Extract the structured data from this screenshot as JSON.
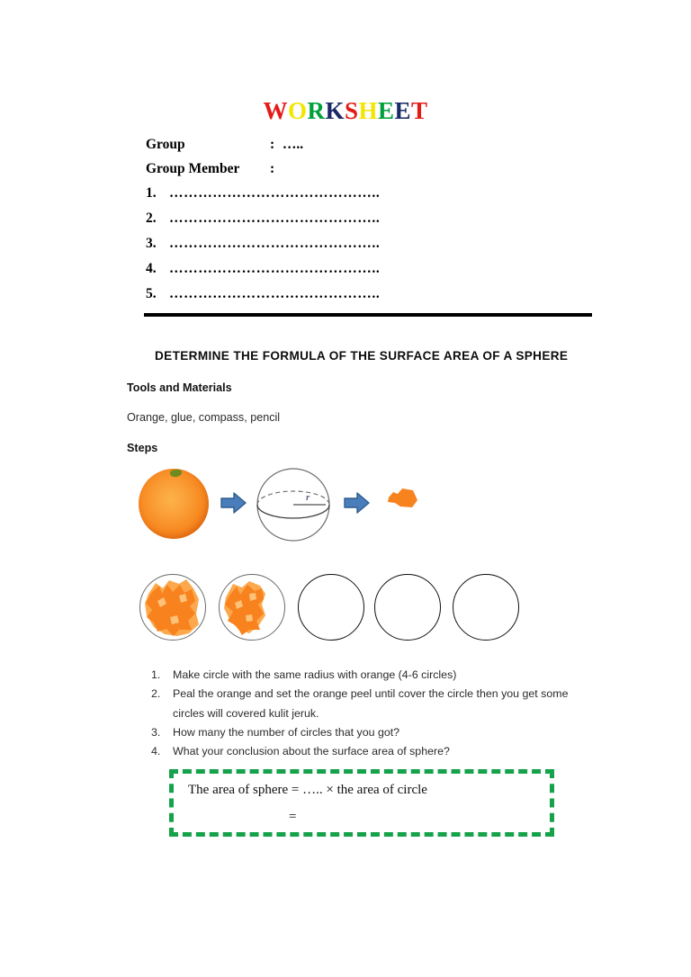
{
  "document": {
    "title_letters": [
      {
        "char": "W",
        "color": "#E31B17"
      },
      {
        "char": "O",
        "color": "#F2E500"
      },
      {
        "char": "R",
        "color": "#00A03C"
      },
      {
        "char": "K",
        "color": "#1B2A66"
      },
      {
        "char": "S",
        "color": "#E31B17"
      },
      {
        "char": "H",
        "color": "#F2E500"
      },
      {
        "char": "E",
        "color": "#00A03C"
      },
      {
        "char": "E",
        "color": "#1B2A66"
      },
      {
        "char": "T",
        "color": "#E31B17"
      }
    ],
    "title_text": "WORKSHEET"
  },
  "form": {
    "group_label": "Group",
    "group_colon": ":",
    "group_value": " …..",
    "member_label": "Group Member",
    "member_colon": ":",
    "members": [
      {
        "num": "1.",
        "dots": "…………………………………….."
      },
      {
        "num": "2.",
        "dots": "…………………………………….."
      },
      {
        "num": "3.",
        "dots": "…………………………………….."
      },
      {
        "num": "4.",
        "dots": "…………………………………….."
      },
      {
        "num": "5.",
        "dots": "…………………………………….."
      }
    ]
  },
  "activity": {
    "heading": "DETERMINE THE FORMULA OF THE SURFACE AREA OF A SPHERE",
    "tools_label": "Tools and Materials",
    "tools_value": "Orange, glue, compass, pencil",
    "steps_label": "Steps"
  },
  "figures": {
    "process_row": {
      "orange_label": "orange-fruit",
      "sphere_radius_label": "r",
      "arrow_color": "#4A7EBB",
      "arrow_outline_color": "#2E5C8F"
    },
    "circles_row": {
      "count": 5,
      "states": [
        "peel-full",
        "peel-partial",
        "empty",
        "empty",
        "empty"
      ],
      "peel_color": "#F7821E",
      "peel_color_light": "#FBA94C",
      "outline_color": "#0F0F0F"
    }
  },
  "instructions": [
    {
      "num": "1.",
      "text": "Make  circle with the same radius with orange (4-6 circles)"
    },
    {
      "num": "2.",
      "text": "Peal the orange and set  the orange peel until cover the circle then you get some circles will covered kulit jeruk."
    },
    {
      "num": "3.",
      "text": "How many the number of circles that you got?"
    },
    {
      "num": "4.",
      "text": "What your conclusion about the surface area of sphere?"
    }
  ],
  "conclusion": {
    "line1": "The area of sphere = ….. × the area of circle",
    "line2": "=",
    "border_color": "#15A24A"
  }
}
